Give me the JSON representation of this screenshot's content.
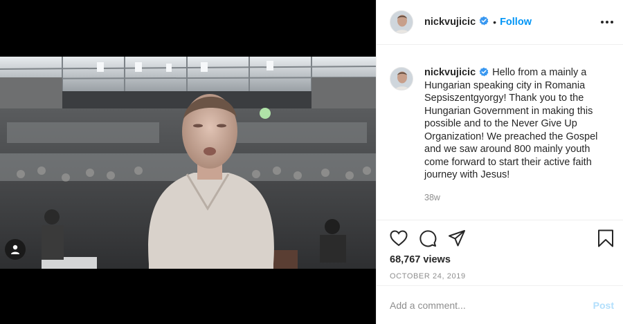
{
  "post": {
    "author": {
      "username": "nickvujicic",
      "verified": true,
      "follow_label": "Follow",
      "separator": "•"
    },
    "media": {
      "type": "video",
      "user_tag_icon": "person-icon"
    },
    "caption": {
      "username": "nickvujicic",
      "text": "Hello from a mainly a Hungarian speaking city in Romania Sepsiszentgyorgy! Thank you to the Hungarian Government in making this possible and to the Never Give Up Organization! We preached the Gospel and we saw around 800 mainly youth come forward to start their active faith journey with Jesus!",
      "time_ago": "38w"
    },
    "actions": {
      "like_icon": "heart-icon",
      "comment_icon": "comment-icon",
      "share_icon": "share-icon",
      "save_icon": "bookmark-icon"
    },
    "views": "68,767 views",
    "date": "OCTOBER 24, 2019",
    "comment_box": {
      "placeholder": "Add a comment...",
      "post_label": "Post"
    }
  },
  "colors": {
    "accent": "#0095f6",
    "post_disabled": "#b2dffc",
    "muted": "#8e8e8e",
    "text": "#262626"
  }
}
